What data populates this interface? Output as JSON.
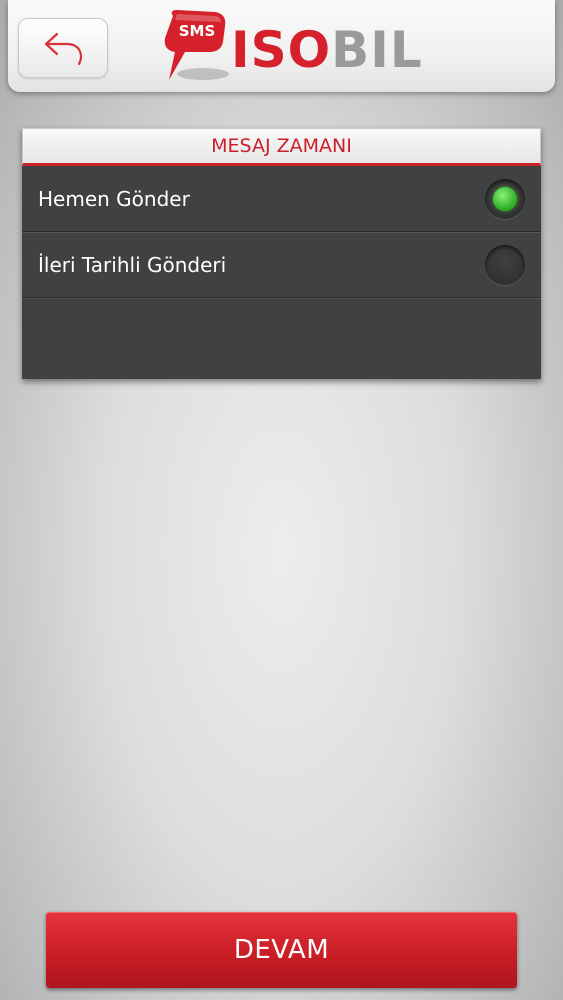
{
  "header": {
    "back_icon": "back-arrow-icon",
    "logo": {
      "badge_text": "SMS",
      "word_red": "ISO",
      "word_gray": "BIL"
    }
  },
  "message_time": {
    "title": "MESAJ ZAMANI",
    "options": [
      {
        "label": "Hemen Gönder",
        "selected": true
      },
      {
        "label": "İleri Tarihli Gönderi",
        "selected": false
      }
    ]
  },
  "footer": {
    "continue_label": "DEVAM"
  },
  "colors": {
    "brand_red": "#d5212b",
    "brand_gray": "#9a9a9a",
    "panel_bg": "#404142",
    "selected_green": "#35b52a"
  }
}
